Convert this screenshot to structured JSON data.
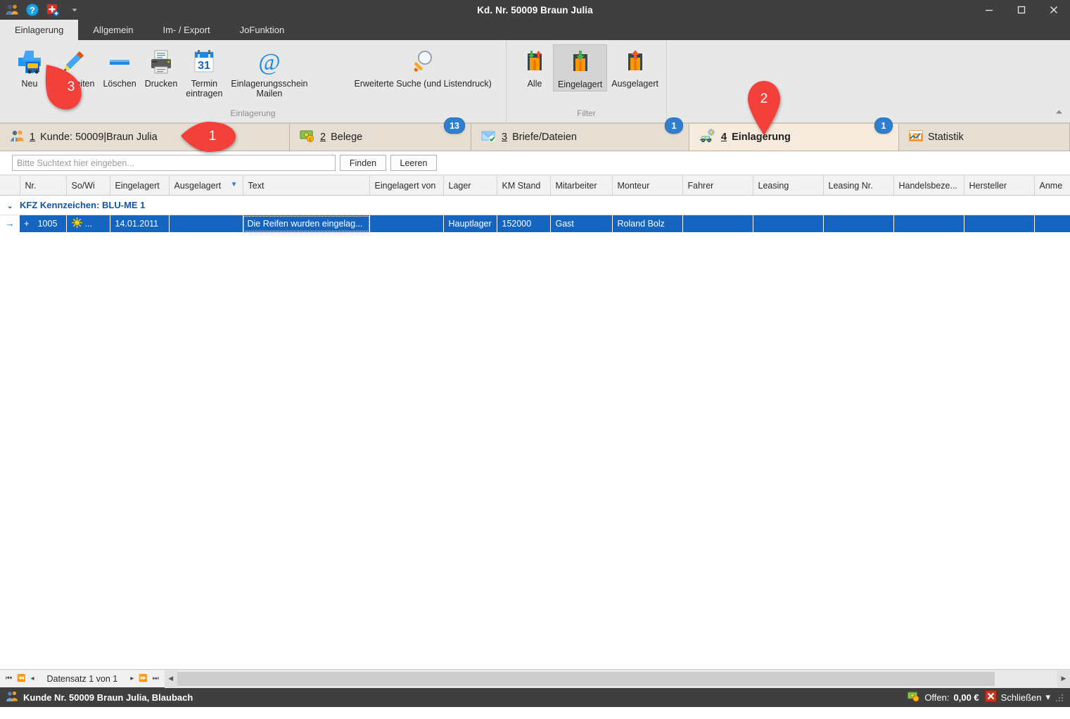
{
  "window": {
    "title": "Kd. Nr. 50009 Braun Julia",
    "quick_access_icons": [
      "customer-icon",
      "help-icon",
      "add-record-icon",
      "dropdown-caret-icon"
    ],
    "controls": {
      "minimize": "–",
      "maximize": "▭",
      "close": "×"
    }
  },
  "ribbon_tabs": [
    {
      "label": "Einlagerung",
      "active": true
    },
    {
      "label": "Allgemein",
      "active": false
    },
    {
      "label": "Im- / Export",
      "active": false
    },
    {
      "label": "JoFunktion",
      "active": false
    }
  ],
  "ribbon": {
    "groups": [
      {
        "title": "Einlagerung",
        "buttons": [
          {
            "label": "Neu",
            "icon": "new-plus-icon",
            "selected": false
          },
          {
            "label": "Bearbeiten",
            "icon": "pencil-edit-icon",
            "selected": false
          },
          {
            "label": "Löschen",
            "icon": "minus-delete-icon",
            "selected": false
          },
          {
            "label": "Drucken",
            "icon": "printer-icon",
            "selected": false
          },
          {
            "label": "Termin\neintragen",
            "label_line1": "Termin",
            "label_line2": "eintragen",
            "icon": "calendar-31-icon",
            "selected": false
          },
          {
            "label": "Einlagerungsschein\nMailen",
            "label_line1": "Einlagerungsschein",
            "label_line2": "Mailen",
            "icon": "at-mail-icon",
            "selected": false
          },
          {
            "label": "Erweiterte Suche (und Listendruck)",
            "label_line1": "Erweiterte Suche (und Listendruck)",
            "label_line2": "",
            "icon": "magnifier-search-icon",
            "selected": false
          }
        ]
      },
      {
        "title": "Filter",
        "buttons": [
          {
            "label": "Alle",
            "icon": "filter-all-icon",
            "selected": false
          },
          {
            "label": "Eingelagert",
            "icon": "filter-stored-in-icon",
            "selected": true
          },
          {
            "label": "Ausgelagert",
            "icon": "filter-stored-out-icon",
            "selected": false
          }
        ]
      }
    ],
    "collapse_label": "▲"
  },
  "nav_tabs": [
    {
      "num": "1",
      "label": " Kunde: 50009|Braun Julia",
      "icon": "customers-icon",
      "badge": "",
      "active": false
    },
    {
      "num": "2",
      "label": " Belege",
      "icon": "money-docs-icon",
      "badge": "13",
      "active": false
    },
    {
      "num": "3",
      "label": " Briefe/Dateien",
      "icon": "mail-check-icon",
      "badge": "1",
      "active": false
    },
    {
      "num": "4",
      "label": " Einlagerung",
      "icon": "car-tire-icon",
      "badge": "1",
      "active": true
    },
    {
      "num": "",
      "label": "Statistik",
      "icon": "statistics-icon",
      "badge": "",
      "active": false
    }
  ],
  "search": {
    "placeholder": "Bitte Suchtext hier eingeben...",
    "value": "",
    "find_label": "Finden",
    "clear_label": "Leeren"
  },
  "grid": {
    "columns": [
      "",
      "Nr.",
      "So/Wi",
      "Eingelagert",
      "Ausgelagert",
      "Text",
      "Eingelagert von",
      "Lager",
      "KM Stand",
      "Mitarbeiter",
      "Monteur",
      "Fahrer",
      "Leasing",
      "Leasing Nr.",
      "Handelsbeze...",
      "Hersteller",
      "Anme"
    ],
    "sorted_column": "Ausgelagert",
    "sort_indicator": "▼",
    "group_row": {
      "chevron": "⌄",
      "label": "KFZ Kennzeichen: BLU-ME 1"
    },
    "rows": [
      {
        "indicator": "→",
        "expand": "+",
        "nr": "1005",
        "sowi": "...",
        "sowi_icon": "sun-icon",
        "eingelagert": "14.01.2011",
        "ausgelagert": "",
        "text": "Die Reifen wurden eingelag...",
        "eingelagert_von": "",
        "lager": "Hauptlager",
        "km_stand": "152000",
        "mitarbeiter": "Gast",
        "monteur": "Roland Bolz",
        "fahrer": "",
        "leasing": "",
        "leasing_nr": "",
        "handelsbeze": "",
        "hersteller": "",
        "anme": ""
      }
    ]
  },
  "record_nav": {
    "first": "⏮",
    "prev_page": "⏪",
    "prev": "◂",
    "info": "Datensatz 1 von 1",
    "next": "▸",
    "next_page": "⏩",
    "last": "⏭",
    "scroll_left": "◀",
    "scroll_right": "▶"
  },
  "statusbar": {
    "icon": "customer-icon",
    "text": "Kunde Nr. 50009 Braun Julia, Blaubach",
    "offen_label": "Offen:",
    "offen_value": "0,00 €",
    "close_label": "Schließen",
    "close_caret": "▾"
  },
  "annotations": [
    {
      "id": "1",
      "number": "1",
      "points": "left",
      "target": "nav-tab-kunde"
    },
    {
      "id": "2",
      "number": "2",
      "points": "down",
      "target": "nav-tab-einlagerung"
    },
    {
      "id": "3",
      "number": "3",
      "points": "up-left",
      "target": "ribbon-button-neu"
    }
  ],
  "colors": {
    "titlebar": "#3f3f3f",
    "ribbon": "#e8e8e8",
    "nav_strip": "#e6ded2",
    "nav_active": "#f7ebdd",
    "row_selected": "#1565C0",
    "badge": "#2f7fd0",
    "pin": "#f4403a",
    "group_label": "#1155a8"
  }
}
